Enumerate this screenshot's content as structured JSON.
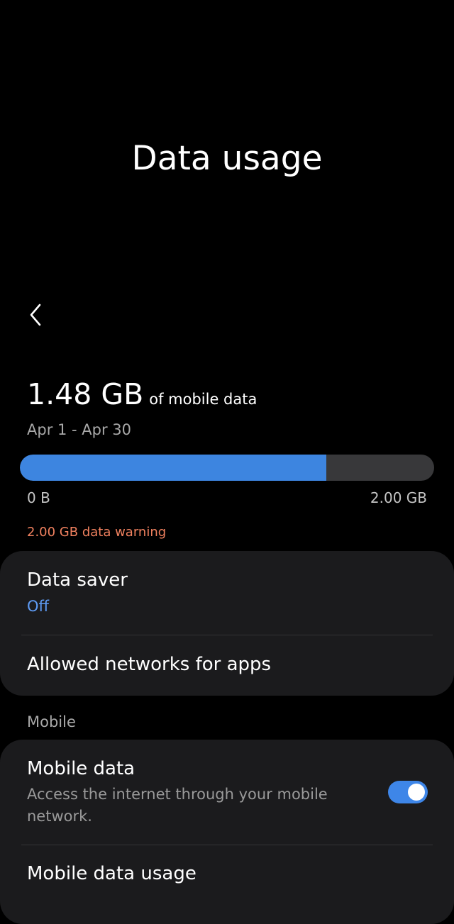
{
  "header": {
    "title": "Data usage",
    "back_icon": "chevron-left-icon"
  },
  "usage": {
    "amount": "1.48 GB",
    "suffix": "of mobile data",
    "period": "Apr 1 - Apr 30",
    "progress_fraction": 0.74,
    "min_label": "0 B",
    "max_label": "2.00 GB",
    "warning": "2.00 GB data warning"
  },
  "card1": {
    "data_saver_title": "Data saver",
    "data_saver_value": "Off",
    "allowed_networks_title": "Allowed networks for apps"
  },
  "mobile_section": {
    "header": "Mobile",
    "mobile_data_title": "Mobile data",
    "mobile_data_desc": "Access the internet through your mobile network.",
    "mobile_data_enabled": true,
    "mobile_data_usage_title": "Mobile data usage"
  },
  "colors": {
    "background": "#000000",
    "card": "#1b1b1d",
    "accent_blue": "#3d85e0",
    "warning": "#f0815f"
  }
}
